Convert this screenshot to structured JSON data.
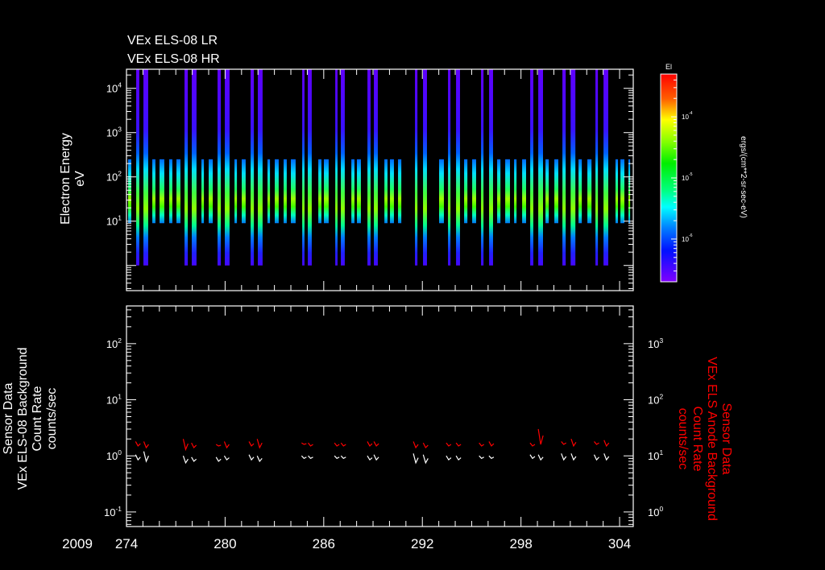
{
  "chart_data": [
    {
      "type": "heatmap",
      "title_lines": [
        "VEx ELS-08 LR",
        "VEx ELS-08 HR"
      ],
      "ylabel": [
        "Electron Energy",
        "eV"
      ],
      "yscale": "log",
      "ylim": [
        0.27,
        27000
      ],
      "xlim": [
        274,
        304.83
      ],
      "yticks": [
        {
          "v": 10,
          "base": "10",
          "exp": "1"
        },
        {
          "v": 100,
          "base": "10",
          "exp": "2"
        },
        {
          "v": 1000,
          "base": "10",
          "exp": "3"
        },
        {
          "v": 10000,
          "base": "10",
          "exp": "4"
        }
      ],
      "low_res_energy_range_eV": [
        9,
        250
      ],
      "high_res_energy_range_eV": [
        1,
        27000
      ],
      "intervals": [
        [
          274.1,
          274.29,
          0
        ],
        [
          274.59,
          274.78,
          1
        ],
        [
          275.03,
          275.32,
          1
        ],
        [
          275.57,
          275.76,
          0
        ],
        [
          276.01,
          276.3,
          0
        ],
        [
          276.6,
          276.79,
          0
        ],
        [
          277.04,
          277.28,
          0
        ],
        [
          277.53,
          277.73,
          1
        ],
        [
          277.97,
          278.26,
          1
        ],
        [
          278.56,
          278.71,
          0
        ],
        [
          279.0,
          279.25,
          0
        ],
        [
          279.54,
          279.74,
          1
        ],
        [
          279.98,
          280.27,
          1
        ],
        [
          280.57,
          280.72,
          0
        ],
        [
          281.01,
          281.25,
          0
        ],
        [
          281.55,
          281.75,
          1
        ],
        [
          281.99,
          282.28,
          1
        ],
        [
          282.58,
          282.73,
          0
        ],
        [
          283.02,
          283.26,
          0
        ],
        [
          283.56,
          283.75,
          0
        ],
        [
          284.0,
          284.29,
          0
        ],
        [
          284.69,
          284.83,
          1
        ],
        [
          285.03,
          285.27,
          1
        ],
        [
          285.67,
          285.86,
          0
        ],
        [
          286.01,
          286.3,
          0
        ],
        [
          286.7,
          286.84,
          1
        ],
        [
          287.04,
          287.28,
          1
        ],
        [
          287.68,
          287.87,
          0
        ],
        [
          288.02,
          288.26,
          0
        ],
        [
          288.66,
          288.85,
          1
        ],
        [
          289.05,
          289.29,
          1
        ],
        [
          289.69,
          289.88,
          0
        ],
        [
          290.03,
          290.27,
          0
        ],
        [
          290.52,
          290.72,
          0
        ],
        [
          291.55,
          291.7,
          1
        ],
        [
          292.04,
          292.28,
          1
        ],
        [
          293.02,
          293.31,
          0
        ],
        [
          293.56,
          293.71,
          1
        ],
        [
          294.05,
          294.29,
          1
        ],
        [
          294.54,
          294.74,
          0
        ],
        [
          295.03,
          295.27,
          0
        ],
        [
          295.57,
          295.72,
          1
        ],
        [
          296.06,
          296.3,
          1
        ],
        [
          296.55,
          296.75,
          0
        ],
        [
          297.04,
          297.33,
          0
        ],
        [
          297.58,
          297.73,
          0
        ],
        [
          298.07,
          298.31,
          0
        ],
        [
          298.56,
          298.75,
          1
        ],
        [
          299.05,
          299.34,
          1
        ],
        [
          299.49,
          299.69,
          0
        ],
        [
          300.03,
          300.27,
          0
        ],
        [
          300.52,
          300.72,
          1
        ],
        [
          301.02,
          301.31,
          1
        ],
        [
          301.5,
          301.7,
          0
        ],
        [
          302.04,
          302.29,
          0
        ],
        [
          302.53,
          302.68,
          1
        ],
        [
          303.02,
          303.31,
          1
        ],
        [
          303.75,
          303.9,
          0
        ],
        [
          304.05,
          304.29,
          0
        ],
        [
          304.54,
          304.64,
          0
        ]
      ],
      "colorbar": {
        "title": "El",
        "label": "ergs/(cm**2-sr-sec-eV)",
        "scale": "log",
        "range": [
          2e-07,
          0.0005
        ],
        "ticks": [
          {
            "v": -4,
            "base": "10",
            "exp": "-4"
          },
          {
            "v": -5,
            "base": "10",
            "exp": "-5"
          },
          {
            "v": -6,
            "base": "10",
            "exp": "-6"
          }
        ],
        "colors": [
          "#ff0000",
          "#ff8000",
          "#ffff00",
          "#80ff00",
          "#00ff00",
          "#00ffff",
          "#0080ff",
          "#0000ff",
          "#8000ff"
        ]
      }
    },
    {
      "type": "line",
      "left_ylabel": [
        "Sensor Data",
        "VEx ELS-08 Background",
        "Count Rate",
        "counts/sec"
      ],
      "right_ylabel": [
        "Sensor Data",
        "VEx ELS Anode Background",
        "Count Rate",
        "counts/sec"
      ],
      "xlim": [
        274,
        304.83
      ],
      "ylim_left": [
        0.055,
        470
      ],
      "ylim_right": [
        0.55,
        4700
      ],
      "left_yticks": [
        {
          "v": 0.1,
          "base": "10",
          "exp": "-1"
        },
        {
          "v": 1,
          "base": "10",
          "exp": "0"
        },
        {
          "v": 10,
          "base": "10",
          "exp": "1"
        },
        {
          "v": 100,
          "base": "10",
          "exp": "2"
        }
      ],
      "right_yticks": [
        {
          "v": 1,
          "base": "10",
          "exp": "0"
        },
        {
          "v": 10,
          "base": "10",
          "exp": "1"
        },
        {
          "v": 100,
          "base": "10",
          "exp": "2"
        },
        {
          "v": 1000,
          "base": "10",
          "exp": "3"
        }
      ],
      "series": [
        {
          "name": "VEx ELS-08 Background",
          "axis": "left",
          "color": "#ffffff",
          "x": [
            274.7,
            275.2,
            277.6,
            278.1,
            279.6,
            280.1,
            281.6,
            282.1,
            284.8,
            285.2,
            286.8,
            287.2,
            288.8,
            289.2,
            291.6,
            292.2,
            293.6,
            294.2,
            295.6,
            296.2,
            298.7,
            299.2,
            300.6,
            301.2,
            302.6,
            303.2
          ],
          "values": [
            [
              0.85,
              1.05
            ],
            [
              0.8,
              1.2
            ],
            [
              0.75,
              1.0
            ],
            [
              0.8,
              0.95
            ],
            [
              0.8,
              0.95
            ],
            [
              0.85,
              1.0
            ],
            [
              0.85,
              1.05
            ],
            [
              0.8,
              1.0
            ],
            [
              0.9,
              1.0
            ],
            [
              0.9,
              1.0
            ],
            [
              0.9,
              1.0
            ],
            [
              0.9,
              1.0
            ],
            [
              0.85,
              1.0
            ],
            [
              0.85,
              1.05
            ],
            [
              0.75,
              1.1
            ],
            [
              0.75,
              1.05
            ],
            [
              0.85,
              1.0
            ],
            [
              0.85,
              1.0
            ],
            [
              0.9,
              1.0
            ],
            [
              0.9,
              1.0
            ],
            [
              0.9,
              1.05
            ],
            [
              0.85,
              1.05
            ],
            [
              0.85,
              1.1
            ],
            [
              0.85,
              1.1
            ],
            [
              0.85,
              1.05
            ],
            [
              0.85,
              1.1
            ]
          ]
        },
        {
          "name": "VEx ELS Anode Background",
          "axis": "right",
          "color": "#ff0000",
          "x": [
            274.7,
            275.2,
            277.6,
            278.1,
            279.6,
            280.1,
            281.6,
            282.1,
            284.8,
            285.2,
            286.8,
            287.2,
            288.8,
            289.2,
            291.6,
            292.2,
            293.6,
            294.2,
            295.6,
            296.2,
            298.7,
            299.2,
            300.6,
            301.2,
            302.6,
            303.2
          ],
          "values": [
            [
              15,
              18
            ],
            [
              14,
              18
            ],
            [
              13,
              20
            ],
            [
              14,
              17
            ],
            [
              15,
              16
            ],
            [
              14,
              18
            ],
            [
              15,
              18
            ],
            [
              14,
              20
            ],
            [
              16,
              17
            ],
            [
              15,
              17
            ],
            [
              15,
              17
            ],
            [
              15,
              17
            ],
            [
              15,
              18
            ],
            [
              15,
              18
            ],
            [
              14,
              18
            ],
            [
              14,
              17
            ],
            [
              15,
              17
            ],
            [
              15,
              17
            ],
            [
              15,
              17
            ],
            [
              15,
              18
            ],
            [
              15,
              17
            ],
            [
              16,
              30
            ],
            [
              16,
              18
            ],
            [
              15,
              20
            ],
            [
              16,
              18
            ],
            [
              15,
              19
            ]
          ]
        }
      ],
      "xticks": [
        "274",
        "280",
        "286",
        "292",
        "298",
        "304"
      ],
      "xtick_values": [
        274,
        280,
        286,
        292,
        298,
        304
      ],
      "year_label": "2009"
    }
  ]
}
